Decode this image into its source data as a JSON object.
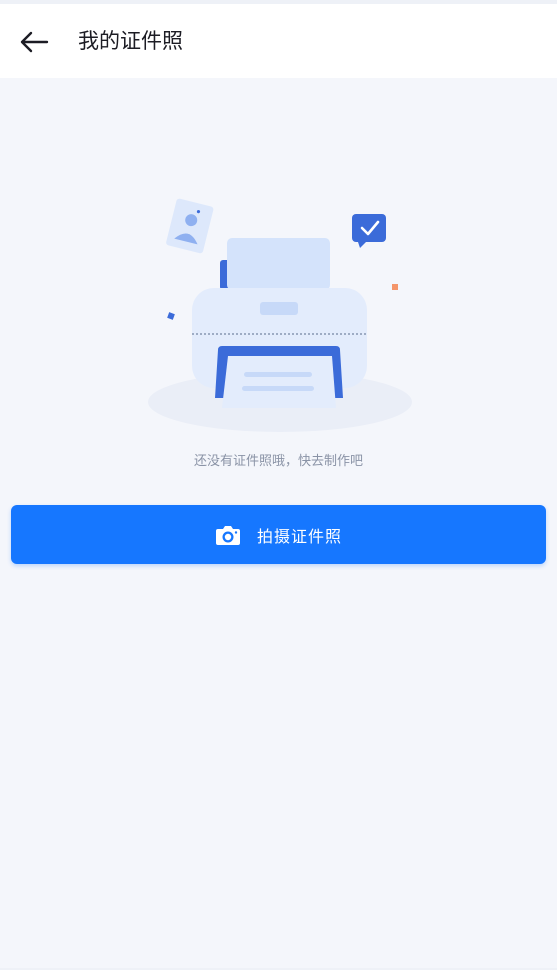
{
  "header": {
    "title": "我的证件照",
    "back_icon": "arrow-left-icon"
  },
  "empty_state": {
    "illustration_icon": "printer-illustration",
    "message": "还没有证件照哦，快去制作吧"
  },
  "action": {
    "icon": "camera-icon",
    "label": "拍摄证件照"
  },
  "colors": {
    "primary": "#1677ff",
    "background": "#f4f6fb",
    "title": "#1c1c24",
    "hint": "#8a93a6"
  }
}
